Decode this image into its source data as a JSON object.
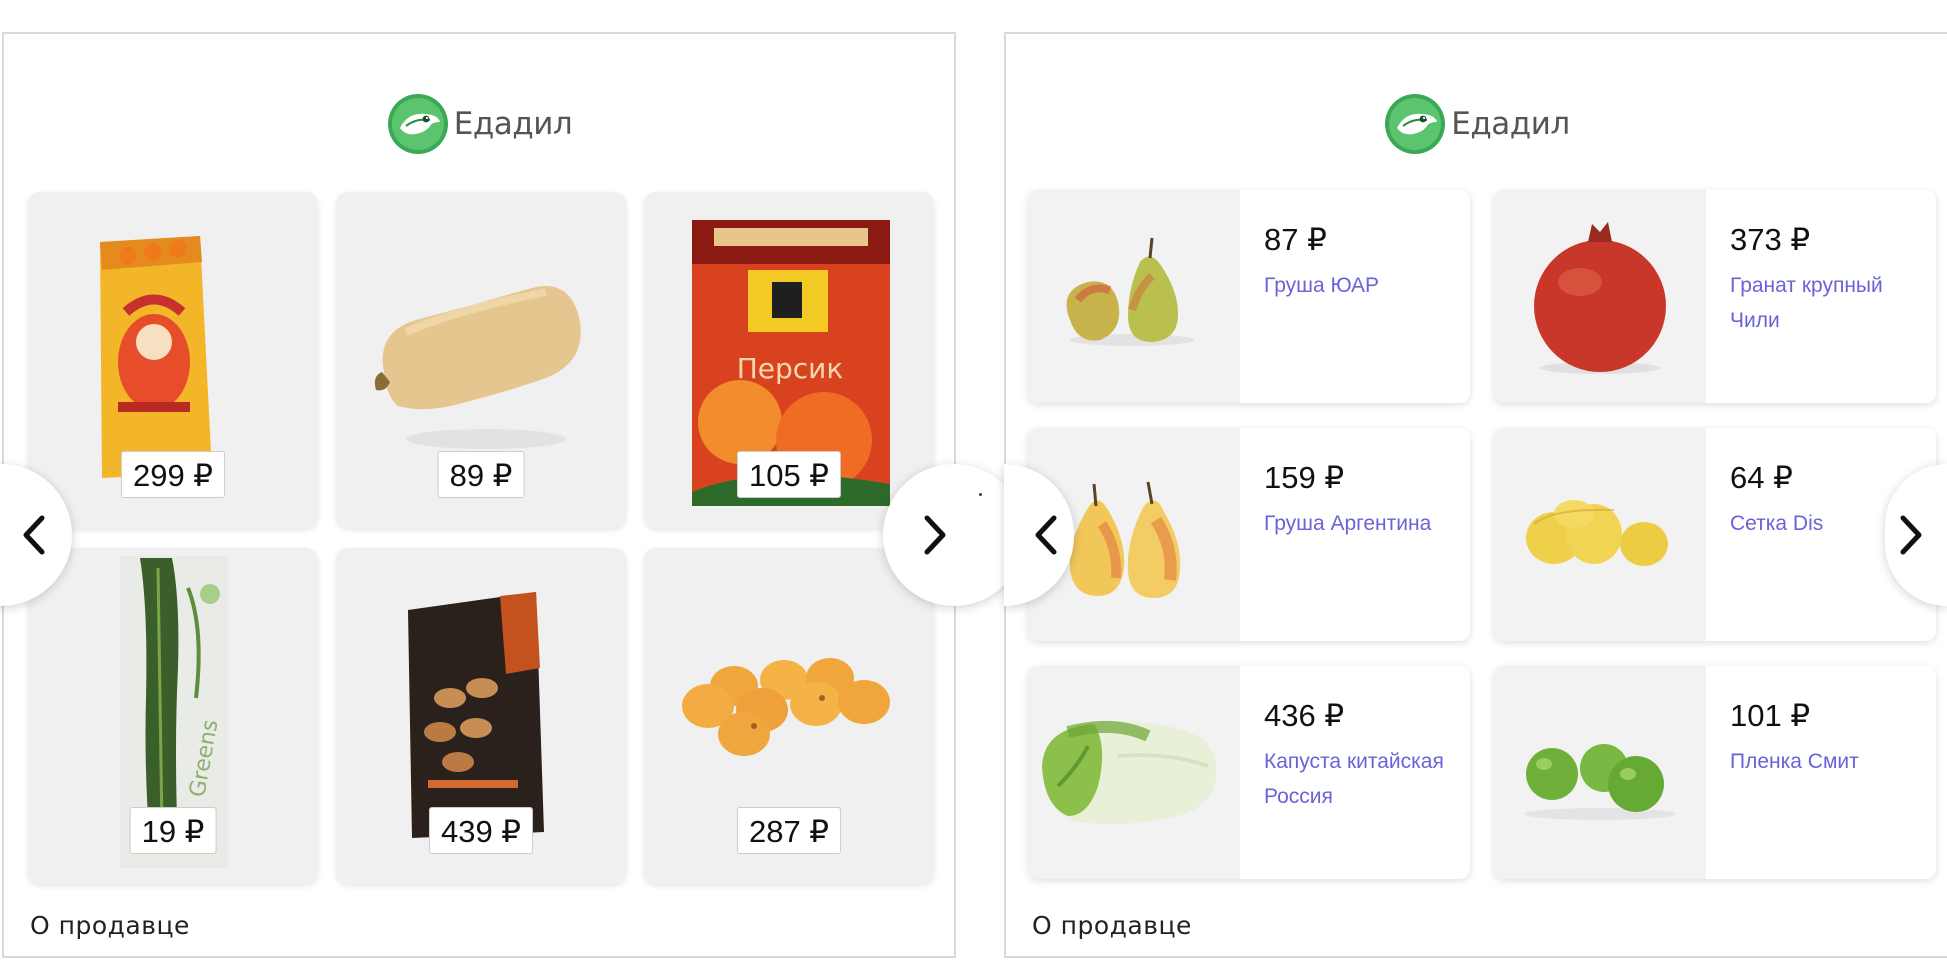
{
  "left_widget": {
    "brand": "Едадил",
    "prices": [
      "299 ₽",
      "89 ₽",
      "105 ₽",
      "19 ₽",
      "439 ₽",
      "287 ₽"
    ],
    "product_images": [
      "sunflower-seeds-pack",
      "butternut-squash",
      "dried-peach-pack",
      "fresh-herbs-bag",
      "nut-box",
      "apricots"
    ],
    "seller_link": "О продавце"
  },
  "right_widget": {
    "brand": "Едадил",
    "cards": [
      {
        "price": "87 ₽",
        "name": "Груша ЮАР",
        "image": "pears"
      },
      {
        "price": "373 ₽",
        "name": "Гранат крупный Чили",
        "image": "pomegranate"
      },
      {
        "price": "159 ₽",
        "name": "Груша Аргентина",
        "image": "pears-yellow"
      },
      {
        "price": "64 ₽",
        "name": "Сетка Dis",
        "image": "lemons"
      },
      {
        "price": "436 ₽",
        "name": "Капуста китайская Россия",
        "image": "chinese-cabbage"
      },
      {
        "price": "101 ₽",
        "name": "Пленка Смит",
        "image": "green-apples"
      }
    ],
    "seller_link": "О продавце"
  },
  "colors": {
    "accent_link": "#6a63d6",
    "tile_background": "#f0f0f1",
    "brand_green": "#3aa854"
  },
  "icons": [
    "edadil-logo",
    "chevron-left-icon",
    "chevron-right-icon"
  ]
}
